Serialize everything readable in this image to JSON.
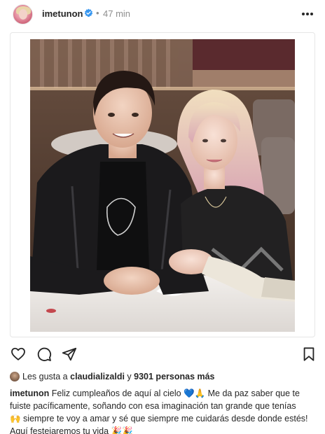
{
  "post": {
    "username": "imetunon",
    "separator": "•",
    "time": "47 min",
    "icons": {
      "more": "more-horizontal-icon",
      "like": "heart-outline-icon",
      "comment": "comment-bubble-icon",
      "share": "send-icon",
      "save": "bookmark-icon",
      "verified": "verified-badge-icon"
    },
    "colors": {
      "verified": "#3897f0",
      "text": "#262626",
      "muted": "#8e8e8e"
    }
  },
  "likes": {
    "prefix": "Les gusta a",
    "user": "claudializaldi",
    "middle": "y",
    "count_text": "9301 personas más"
  },
  "caption": {
    "username": "imetunon",
    "line1": "Feliz cumpleaños de aquí al cielo 💙🙏 Me da paz saber que te",
    "line2": "fuiste pacíficamente, soñando con esa imaginación tan grande que tenías",
    "line3": "🙌 siempre te voy a amar y sé que siempre me cuidarás desde donde estés!",
    "line4": "Aquí festejaremos tu vida 🎉🎉"
  }
}
